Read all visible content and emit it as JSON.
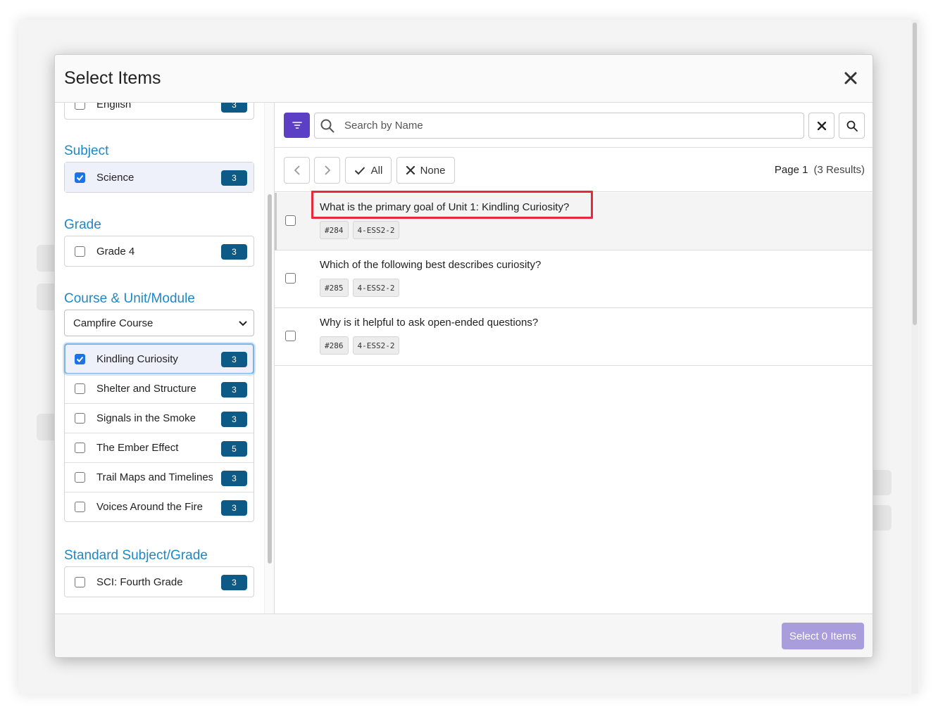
{
  "modal": {
    "title": "Select Items"
  },
  "sidebar": {
    "language_group": {
      "items": [
        {
          "label": "English",
          "count": "3",
          "checked": false
        }
      ]
    },
    "subject": {
      "heading": "Subject",
      "items": [
        {
          "label": "Science",
          "count": "3",
          "checked": true
        }
      ]
    },
    "grade": {
      "heading": "Grade",
      "items": [
        {
          "label": "Grade 4",
          "count": "3",
          "checked": false
        }
      ]
    },
    "course": {
      "heading": "Course & Unit/Module",
      "selected_course": "Campfire Course",
      "units": [
        {
          "label": "Kindling Curiosity",
          "count": "3",
          "checked": true
        },
        {
          "label": "Shelter and Structure",
          "count": "3",
          "checked": false
        },
        {
          "label": "Signals in the Smoke",
          "count": "3",
          "checked": false
        },
        {
          "label": "The Ember Effect",
          "count": "5",
          "checked": false
        },
        {
          "label": "Trail Maps and Timelines",
          "count": "3",
          "checked": false
        },
        {
          "label": "Voices Around the Fire",
          "count": "3",
          "checked": false
        }
      ]
    },
    "standard": {
      "heading": "Standard Subject/Grade",
      "items": [
        {
          "label": "SCI: Fourth Grade",
          "count": "3",
          "checked": false
        }
      ]
    }
  },
  "toolbar": {
    "search_placeholder": "Search by Name",
    "search_value": ""
  },
  "pager": {
    "all_label": "All",
    "none_label": "None",
    "page_label": "Page 1",
    "results_label": "(3 Results)"
  },
  "results": [
    {
      "title": "What is the primary goal of Unit 1: Kindling Curiosity?",
      "tags": [
        "#284",
        "4-ESS2-2"
      ],
      "checked": false,
      "highlighted": true
    },
    {
      "title": "Which of the following best describes curiosity?",
      "tags": [
        "#285",
        "4-ESS2-2"
      ],
      "checked": false,
      "highlighted": false
    },
    {
      "title": "Why is it helpful to ask open-ended questions?",
      "tags": [
        "#286",
        "4-ESS2-2"
      ],
      "checked": false,
      "highlighted": false
    }
  ],
  "footer": {
    "submit_label": "Select 0 Items"
  },
  "colors": {
    "accent": "#1e88c7",
    "badge": "#0e5a86",
    "filter_button": "#5b3fc4",
    "submit_disabled": "#a99ddb",
    "highlight_outline": "#e8283c"
  }
}
